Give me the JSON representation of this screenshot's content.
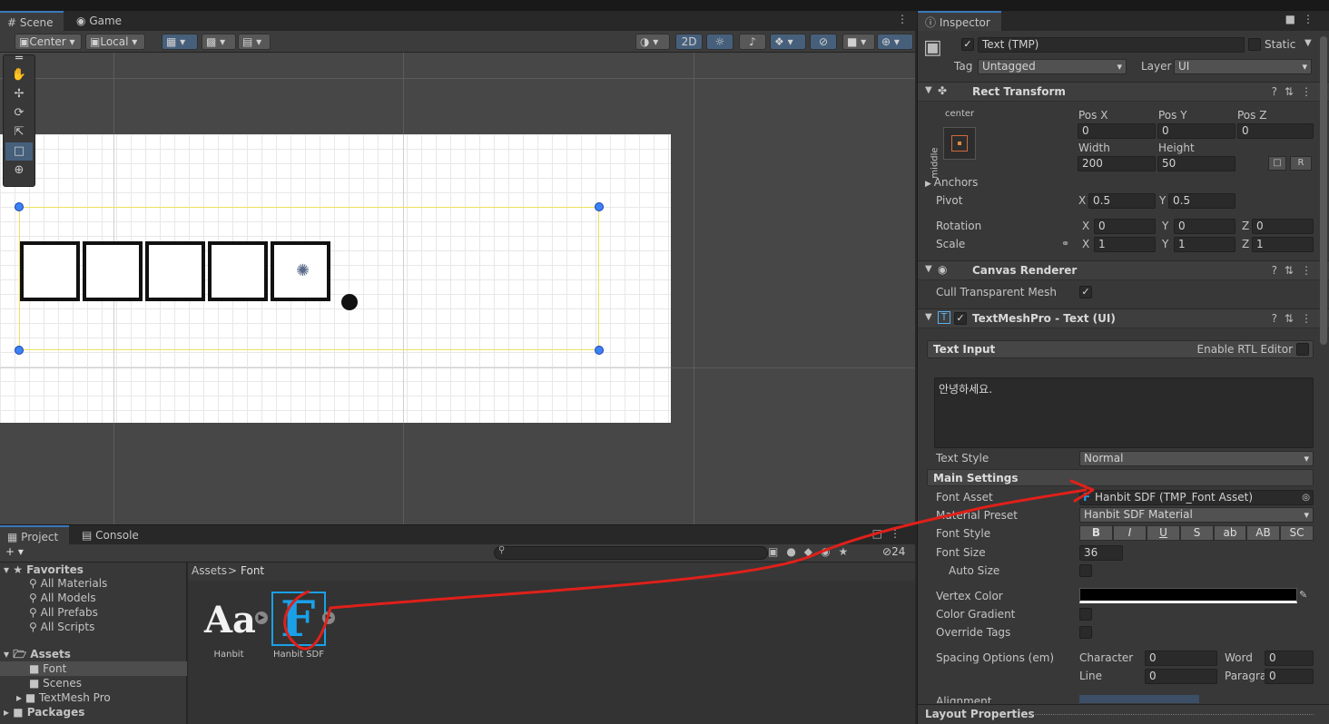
{
  "scene_tabs": {
    "scene": "Scene",
    "game": "Game"
  },
  "scene_toolbar": {
    "pivot": "Center",
    "space": "Local",
    "mode2d": "2D"
  },
  "project_tabs": {
    "project": "Project",
    "console": "Console"
  },
  "project": {
    "hidden_count": "24",
    "favorites": {
      "label": "Favorites",
      "items": [
        "All Materials",
        "All Models",
        "All Prefabs",
        "All Scripts"
      ]
    },
    "assets_label": "Assets",
    "asset_folders": [
      "Font",
      "Scenes",
      "TextMesh Pro"
    ],
    "packages_label": "Packages",
    "breadcrumb": {
      "root": "Assets",
      "sep": ">",
      "current": "Font"
    },
    "files": [
      {
        "name": "Hanbit",
        "glyph": "Aa"
      },
      {
        "name": "Hanbit SDF",
        "glyph": "F"
      }
    ]
  },
  "inspector": {
    "tab": "Inspector",
    "object_name": "Text (TMP)",
    "static_label": "Static",
    "tag_label": "Tag",
    "tag_value": "Untagged",
    "layer_label": "Layer",
    "layer_value": "UI",
    "rect_transform": {
      "title": "Rect Transform",
      "anchor_h": "center",
      "anchor_v": "middle",
      "pos_x_label": "Pos X",
      "pos_y_label": "Pos Y",
      "pos_z_label": "Pos Z",
      "pos_x": "0",
      "pos_y": "0",
      "pos_z": "0",
      "width_label": "Width",
      "height_label": "Height",
      "width": "200",
      "height": "50",
      "r_button": "R",
      "anchors_label": "Anchors",
      "pivot_label": "Pivot",
      "pivot_x": "0.5",
      "pivot_y": "0.5",
      "rotation_label": "Rotation",
      "rot_x": "0",
      "rot_y": "0",
      "rot_z": "0",
      "scale_label": "Scale",
      "scale_x": "1",
      "scale_y": "1",
      "scale_z": "1",
      "x": "X",
      "y": "Y",
      "z": "Z"
    },
    "canvas_renderer": {
      "title": "Canvas Renderer",
      "cull_label": "Cull Transparent Mesh"
    },
    "tmp": {
      "title": "TextMeshPro - Text (UI)",
      "text_input_label": "Text Input",
      "rtl_label": "Enable RTL Editor",
      "text_value": "안녕하세요.",
      "text_style_label": "Text Style",
      "text_style_value": "Normal",
      "main_settings_label": "Main Settings",
      "font_asset_label": "Font Asset",
      "font_asset_value": "Hanbit SDF (TMP_Font Asset)",
      "material_preset_label": "Material Preset",
      "material_preset_value": "Hanbit SDF Material",
      "font_style_label": "Font Style",
      "font_style_buttons": [
        "B",
        "I",
        "U",
        "S",
        "ab",
        "AB",
        "SC"
      ],
      "font_size_label": "Font Size",
      "font_size_value": "36",
      "auto_size_label": "Auto Size",
      "vertex_color_label": "Vertex Color",
      "color_gradient_label": "Color Gradient",
      "override_tags_label": "Override Tags",
      "spacing_label": "Spacing Options (em)",
      "character_label": "Character",
      "character_value": "0",
      "word_label": "Word",
      "word_value": "0",
      "line_label": "Line",
      "line_value": "0",
      "paragraph_label": "Paragraph",
      "paragraph_value": "0",
      "alignment_label": "Alignment"
    },
    "footer_label": "Layout Properties"
  },
  "colors": {
    "accent": "#3a79bb",
    "selection_outline": "#f0e060",
    "annotation_red": "#e0201a",
    "tmp_icon_blue": "#1aa0e8"
  }
}
